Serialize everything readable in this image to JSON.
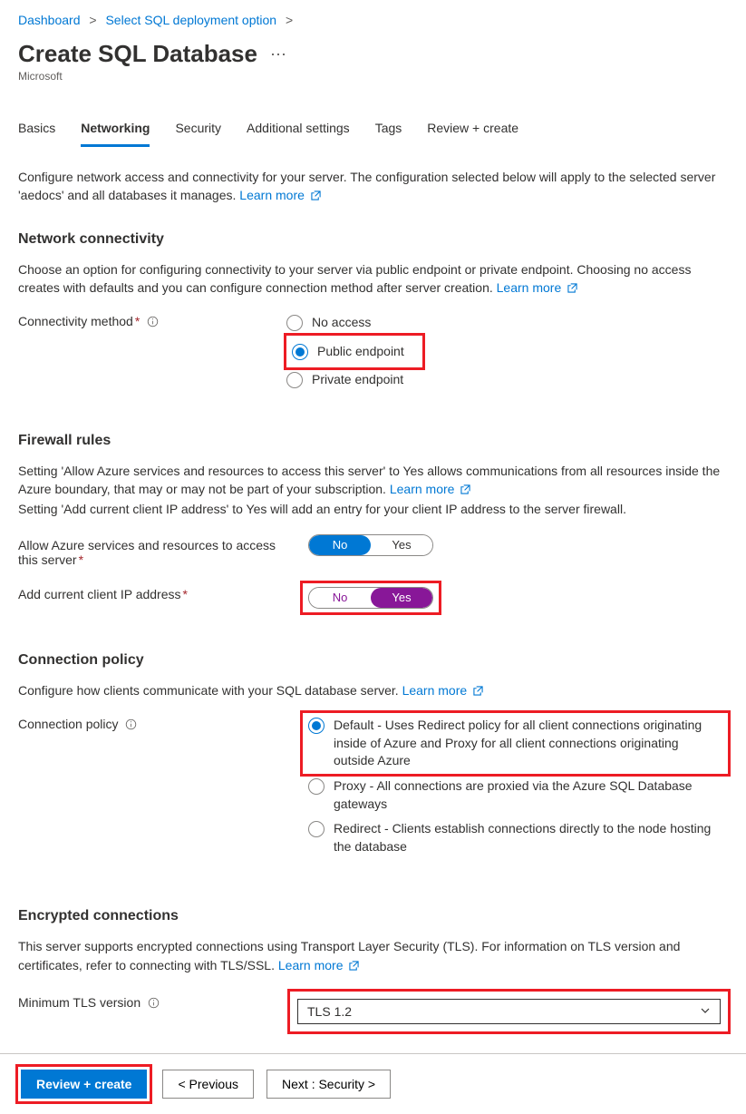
{
  "breadcrumb": {
    "items": [
      "Dashboard",
      "Select SQL deployment option"
    ]
  },
  "page_title": "Create SQL Database",
  "publisher": "Microsoft",
  "tabs": [
    "Basics",
    "Networking",
    "Security",
    "Additional settings",
    "Tags",
    "Review + create"
  ],
  "active_tab": "Networking",
  "intro": {
    "text": "Configure network access and connectivity for your server. The configuration selected below will apply to the selected server 'aedocs' and all databases it manages.",
    "learn_more": "Learn more"
  },
  "network_connectivity": {
    "heading": "Network connectivity",
    "desc": "Choose an option for configuring connectivity to your server via public endpoint or private endpoint. Choosing no access creates with defaults and you can configure connection method after server creation.",
    "learn_more": "Learn more",
    "label": "Connectivity method",
    "options": [
      "No access",
      "Public endpoint",
      "Private endpoint"
    ],
    "selected": "Public endpoint"
  },
  "firewall": {
    "heading": "Firewall rules",
    "desc1": "Setting 'Allow Azure services and resources to access this server' to Yes allows communications from all resources inside the Azure boundary, that may or may not be part of your subscription.",
    "learn_more": "Learn more",
    "desc2": "Setting 'Add current client IP address' to Yes will add an entry for your client IP address to the server firewall.",
    "allow_label": "Allow Azure services and resources to access this server",
    "allow_value": "No",
    "addip_label": "Add current client IP address",
    "addip_value": "Yes",
    "toggle_no": "No",
    "toggle_yes": "Yes"
  },
  "connection_policy": {
    "heading": "Connection policy",
    "desc": "Configure how clients communicate with your SQL database server.",
    "learn_more": "Learn more",
    "label": "Connection policy",
    "options": [
      "Default - Uses Redirect policy for all client connections originating inside of Azure and Proxy for all client connections originating outside Azure",
      "Proxy - All connections are proxied via the Azure SQL Database gateways",
      "Redirect - Clients establish connections directly to the node hosting the database"
    ],
    "selected_index": 0
  },
  "encrypted": {
    "heading": "Encrypted connections",
    "desc": "This server supports encrypted connections using Transport Layer Security (TLS). For information on TLS version and certificates, refer to connecting with TLS/SSL.",
    "learn_more": "Learn more",
    "label": "Minimum TLS version",
    "value": "TLS 1.2"
  },
  "footer": {
    "review": "Review + create",
    "previous": "< Previous",
    "next": "Next : Security >"
  }
}
